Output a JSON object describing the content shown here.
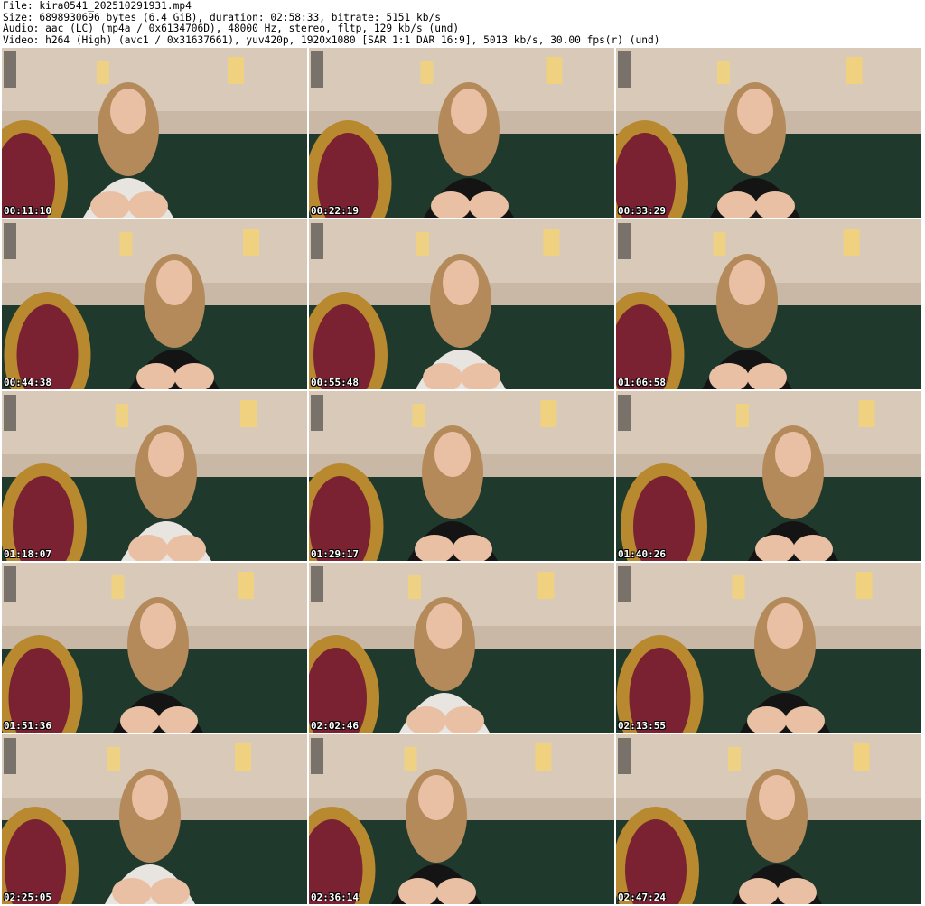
{
  "header": {
    "file_line": "File: kira0541_202510291931.mp4",
    "size_line": "Size: 6898930696 bytes (6.4 GiB), duration: 02:58:33, bitrate: 5151 kb/s",
    "audio_line": "Audio: aac (LC) (mp4a / 0x6134706D), 48000 Hz, stereo, fltp, 129 kb/s (und)",
    "video_line": "Video: h264 (High) (avc1 / 0x31637661), yuv420p, 1920x1080 [SAR 1:1 DAR 16:9], 5013 kb/s, 30.00 fps(r) (und)"
  },
  "thumbnails": [
    {
      "timestamp": "00:11:10"
    },
    {
      "timestamp": "00:22:19"
    },
    {
      "timestamp": "00:33:29"
    },
    {
      "timestamp": "00:44:38"
    },
    {
      "timestamp": "00:55:48"
    },
    {
      "timestamp": "01:06:58"
    },
    {
      "timestamp": "01:18:07"
    },
    {
      "timestamp": "01:29:17"
    },
    {
      "timestamp": "01:40:26"
    },
    {
      "timestamp": "01:51:36"
    },
    {
      "timestamp": "02:02:46"
    },
    {
      "timestamp": "02:13:55"
    },
    {
      "timestamp": "02:25:05"
    },
    {
      "timestamp": "02:36:14"
    },
    {
      "timestamp": "02:47:24"
    }
  ],
  "colors": {
    "background": "#ffffff",
    "wall": "#c9b8a6",
    "sofa": "#1f3a2c",
    "chair_gold": "#b8892e",
    "chair_red": "#7a2232",
    "hair": "#b48a5a",
    "skin": "#e9c0a4",
    "black_top": "#141414",
    "white_top": "#e8e4e0",
    "lamp": "#f3d27a"
  }
}
